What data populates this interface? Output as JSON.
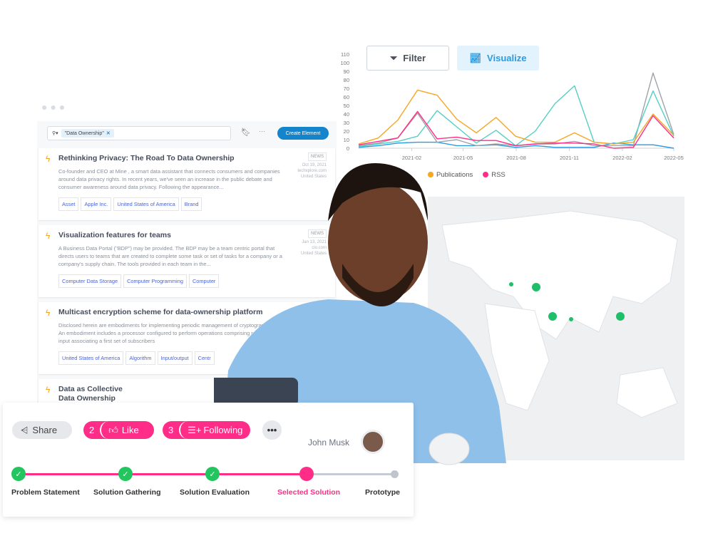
{
  "search": {
    "chip": "\"Data Ownership\"",
    "create_label": "Create Element"
  },
  "results": [
    {
      "title": "Rethinking Privacy: The Road To Data Ownership",
      "snippet": "Co-founder and CEO at Mine , a smart data assistant that connects consumers and companies around data privacy rights. In recent years, we've seen an increase in the public debate and consumer awareness around data privacy. Following the appearance...",
      "type": "NEWS",
      "date": "Oct 19, 2021",
      "source": "techxplore.com",
      "country": "United States",
      "tags": [
        "Asset",
        "Apple Inc.",
        "United States of America",
        "Brand"
      ]
    },
    {
      "title": "Visualization features for teams",
      "snippet": "A Business Data Portal (\"BDP\") may be provided. The BDP may be a team centric portal that directs users to teams that are created to complete some task or set of tasks for a company or a company's supply chain. The tools provided in each team in the...",
      "type": "NEWS",
      "date": "Jan 13, 2021",
      "source": "cio.com",
      "country": "United States",
      "tags": [
        "Computer Data Storage",
        "Computer Programming",
        "Computer"
      ]
    },
    {
      "title": "Multicast encryption scheme for data-ownership platform",
      "snippet": "Disclosed herein are embodiments for implementing periodic management of cryptographic keys. An embodiment includes a processor configured to perform operations comprising receive a first input associating a first set of subscribers",
      "tags": [
        "United States of America",
        "Algorithm",
        "Input/output",
        "Centr"
      ]
    },
    {
      "title": "Data as Collective",
      "title2": "Data Ownership"
    }
  ],
  "toolbar": {
    "filter_label": "Filter",
    "visualize_label": "Visualize"
  },
  "chart_data": {
    "type": "line",
    "yticks": [
      "0",
      "10",
      "20",
      "30",
      "40",
      "50",
      "60",
      "70",
      "80",
      "90",
      "100",
      "110"
    ],
    "ylim": [
      0,
      110
    ],
    "xticks": [
      "2021-02",
      "2021-05",
      "2021-08",
      "2021-11",
      "2022-02",
      "2022-05"
    ],
    "x": [
      "2020-11-01",
      "2020-12-05",
      "2021-01-08",
      "2021-02-11",
      "2021-03-17",
      "2021-04-20",
      "2021-05-24",
      "2021-06-27",
      "2021-07-31",
      "2021-09-03",
      "2021-10-07",
      "2021-11-10",
      "2021-12-14",
      "2022-01-17",
      "2022-02-20",
      "2022-03-26",
      "2022-05-01"
    ],
    "series": [
      {
        "color": "#2b9be0",
        "values": [
          1,
          3,
          6,
          7,
          7,
          3,
          3,
          4,
          1,
          3,
          1,
          1,
          1,
          6,
          4,
          4,
          0
        ]
      },
      {
        "color": "#9ea3aa",
        "values": [
          3,
          6,
          12,
          41,
          7,
          10,
          3,
          5,
          3,
          5,
          5,
          8,
          3,
          3,
          3,
          88,
          16
        ]
      },
      {
        "color": "#55cfc4",
        "values": [
          2,
          5,
          8,
          14,
          44,
          25,
          6,
          21,
          3,
          20,
          52,
          73,
          7,
          5,
          10,
          67,
          14
        ]
      },
      {
        "name": "Publications",
        "color": "#f5a623",
        "values": [
          5,
          12,
          33,
          68,
          62,
          34,
          18,
          36,
          14,
          7,
          7,
          18,
          7,
          5,
          7,
          40,
          15
        ]
      },
      {
        "name": "RSS",
        "color": "#ff2d87",
        "values": [
          4,
          8,
          12,
          43,
          11,
          13,
          9,
          9,
          3,
          5,
          6,
          6,
          5,
          0,
          1,
          38,
          12
        ]
      }
    ],
    "grid": false,
    "legend": "bottom"
  },
  "actions": {
    "share": "Share",
    "like_count": "2",
    "like": "Like",
    "follow_count": "3",
    "following": "Following",
    "user": "John Musk"
  },
  "steps": [
    {
      "label": "Problem Statement",
      "state": "done"
    },
    {
      "label": "Solution Gathering",
      "state": "done"
    },
    {
      "label": "Solution Evaluation",
      "state": "done"
    },
    {
      "label": "Selected Solution",
      "state": "current"
    },
    {
      "label": "Prototype",
      "state": "todo"
    }
  ],
  "colors": {
    "accent": "#ff2d87",
    "done": "#22c55e",
    "primary": "#1485cc"
  }
}
